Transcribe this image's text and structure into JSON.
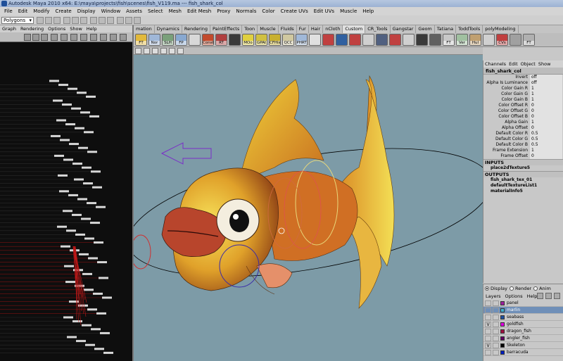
{
  "window": {
    "title": "Autodesk Maya 2010 x64: E:\\maya\\projects\\fish\\scenes\\fish_V119.ma  ---  fish_shark_col"
  },
  "menubar": [
    "File",
    "Edit",
    "Modify",
    "Create",
    "Display",
    "Window",
    "Assets",
    "Select",
    "Mesh",
    "Edit Mesh",
    "Proxy",
    "Normals",
    "Color",
    "Create UVs",
    "Edit UVs",
    "Muscle",
    "Help"
  ],
  "status": {
    "mode": "Polygons"
  },
  "outliner": {
    "menu": [
      "Graph",
      "Rendering",
      "Options",
      "Show",
      "Help"
    ]
  },
  "shelf": {
    "tabs": [
      "mation",
      "Dynamics",
      "Rendering",
      "PaintEffects",
      "Toon",
      "Muscle",
      "Fluids",
      "Fur",
      "Hair",
      "nCloth",
      "Custom",
      "CR_Tools",
      "Gangstar",
      "Geom",
      "Tatiana",
      "ToddTools",
      "polyModeling"
    ],
    "active_tab": "Custom",
    "icons": [
      {
        "label": "FT",
        "color": "#e2b93b"
      },
      {
        "label": "Nor",
        "color": "#9fb7d8"
      },
      {
        "label": "SLH",
        "color": "#7aa07a"
      },
      {
        "label": "FP",
        "color": "#88a8d0"
      },
      {
        "label": "",
        "color": "#d8d8d8"
      },
      {
        "label": "Const",
        "color": "#c24a2c"
      },
      {
        "label": "RT",
        "color": "#b04040"
      },
      {
        "label": "",
        "color": "#3a3a3a"
      },
      {
        "label": "MOo",
        "color": "#e0d040"
      },
      {
        "label": "GPAt",
        "color": "#d0c040"
      },
      {
        "label": "CFHis",
        "color": "#c8b030"
      },
      {
        "label": "QCC",
        "color": "#d0c8a0"
      },
      {
        "label": "PHRT",
        "color": "#a0b8d8"
      },
      {
        "label": "",
        "color": "#e0e0e0"
      },
      {
        "label": "",
        "color": "#c04040"
      },
      {
        "label": "",
        "color": "#3060a0"
      },
      {
        "label": "",
        "color": "#c04040"
      },
      {
        "label": "",
        "color": "#d0d0d0"
      },
      {
        "label": "",
        "color": "#506080"
      },
      {
        "label": "",
        "color": "#c04040"
      },
      {
        "label": "",
        "color": "#d0d0d0"
      },
      {
        "label": "",
        "color": "#3a3a3a"
      },
      {
        "label": "",
        "color": "#606060"
      },
      {
        "label": "FT",
        "color": "#c8c8c8"
      },
      {
        "label": "Ver",
        "color": "#a0c0a0"
      },
      {
        "label": "Hul",
        "color": "#c0a070"
      },
      {
        "label": "",
        "color": "#d0d0d0"
      },
      {
        "label": "CVs",
        "color": "#c04040"
      },
      {
        "label": "",
        "color": "#a0a0a0"
      },
      {
        "label": "FT",
        "color": "#b0b0b0"
      }
    ]
  },
  "attribute_editor": {
    "menu": [
      "Channels",
      "Edit",
      "Object",
      "Show"
    ],
    "node": "fish_shark_col",
    "channels": [
      {
        "label": "Invert",
        "value": "off"
      },
      {
        "label": "Alpha Is Luminance",
        "value": "off"
      },
      {
        "label": "Color Gain R",
        "value": "1"
      },
      {
        "label": "Color Gain G",
        "value": "1"
      },
      {
        "label": "Color Gain B",
        "value": "1"
      },
      {
        "label": "Color Offset R",
        "value": "0"
      },
      {
        "label": "Color Offset G",
        "value": "0"
      },
      {
        "label": "Color Offset B",
        "value": "0"
      },
      {
        "label": "Alpha Gain",
        "value": "1"
      },
      {
        "label": "Alpha Offset",
        "value": "0"
      },
      {
        "label": "Default Color R",
        "value": "0.5"
      },
      {
        "label": "Default Color G",
        "value": "0.5"
      },
      {
        "label": "Default Color B",
        "value": "0.5"
      },
      {
        "label": "Frame Extension",
        "value": "1"
      },
      {
        "label": "Frame Offset",
        "value": "0"
      }
    ],
    "inputs_title": "INPUTS",
    "inputs": [
      "place2dTexture5"
    ],
    "outputs_title": "OUTPUTS",
    "outputs": [
      "fish_shark_tex_01",
      "defaultTextureList1",
      "materialInfo5"
    ]
  },
  "layers": {
    "radios": [
      {
        "label": "Display",
        "on": true
      },
      {
        "label": "Render",
        "on": false
      },
      {
        "label": "Anim",
        "on": false
      }
    ],
    "menu": [
      "Layers",
      "Options",
      "Help"
    ],
    "rows": [
      {
        "name": "panel",
        "visible": "",
        "color": "#a020a0",
        "selected": false
      },
      {
        "name": "marlin",
        "visible": "",
        "color": "#40b0d0",
        "selected": true
      },
      {
        "name": "seabass",
        "visible": "",
        "color": "#2050a0",
        "selected": false
      },
      {
        "name": "goldfish",
        "visible": "V",
        "color": "#e000e0",
        "selected": false
      },
      {
        "name": "dragon_fish",
        "visible": "",
        "color": "#a01040",
        "selected": false
      },
      {
        "name": "angler_fish",
        "visible": "",
        "color": "#600060",
        "selected": false
      },
      {
        "name": "Skeleton",
        "visible": "V",
        "color": "#000000",
        "selected": false
      },
      {
        "name": "barracuda",
        "visible": "",
        "color": "#0020c0",
        "selected": false
      }
    ]
  }
}
